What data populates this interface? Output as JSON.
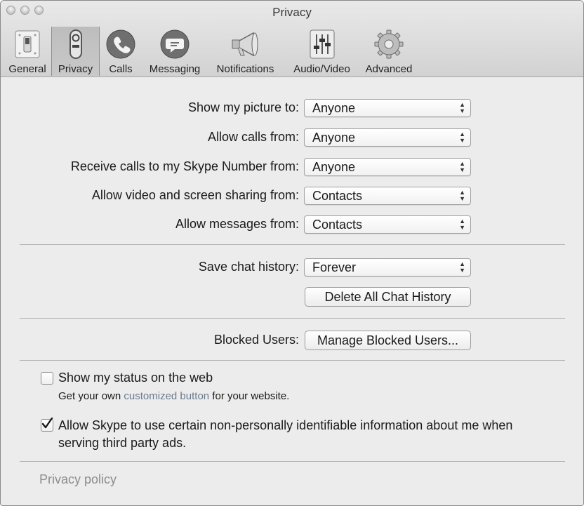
{
  "window": {
    "title": "Privacy"
  },
  "toolbar": {
    "items": [
      {
        "label": "General",
        "icon": "switch-icon"
      },
      {
        "label": "Privacy",
        "icon": "privacy-lock-icon",
        "selected": true
      },
      {
        "label": "Calls",
        "icon": "phone-icon"
      },
      {
        "label": "Messaging",
        "icon": "chat-bubble-icon"
      },
      {
        "label": "Notifications",
        "icon": "megaphone-icon"
      },
      {
        "label": "Audio/Video",
        "icon": "mixer-sliders-icon"
      },
      {
        "label": "Advanced",
        "icon": "gear-icon"
      }
    ]
  },
  "settings": {
    "show_picture": {
      "label": "Show my picture to:",
      "value": "Anyone"
    },
    "allow_calls": {
      "label": "Allow calls from:",
      "value": "Anyone"
    },
    "skype_number": {
      "label": "Receive calls to my Skype Number from:",
      "value": "Anyone"
    },
    "video_sharing": {
      "label": "Allow video and screen sharing from:",
      "value": "Contacts"
    },
    "messages": {
      "label": "Allow messages from:",
      "value": "Contacts"
    },
    "chat_history": {
      "label": "Save chat history:",
      "value": "Forever"
    },
    "delete_history_button": "Delete All Chat History",
    "blocked_users": {
      "label": "Blocked Users:",
      "button": "Manage Blocked Users..."
    }
  },
  "options": {
    "status_web": {
      "label": "Show my status on the web",
      "checked": false,
      "sub_prefix": "Get your own ",
      "sub_link": "customized button",
      "sub_suffix": " for your website."
    },
    "ads": {
      "label_line1": "Allow Skype to use certain non-personally identifiable information about me when",
      "label_line2": "serving third party ads.",
      "checked": true
    }
  },
  "footer": {
    "privacy_policy": "Privacy policy"
  },
  "colors": {
    "link": "#6b7b8d",
    "footer_link": "#8c8c8c",
    "selected_tab": "#c4c4c4"
  }
}
